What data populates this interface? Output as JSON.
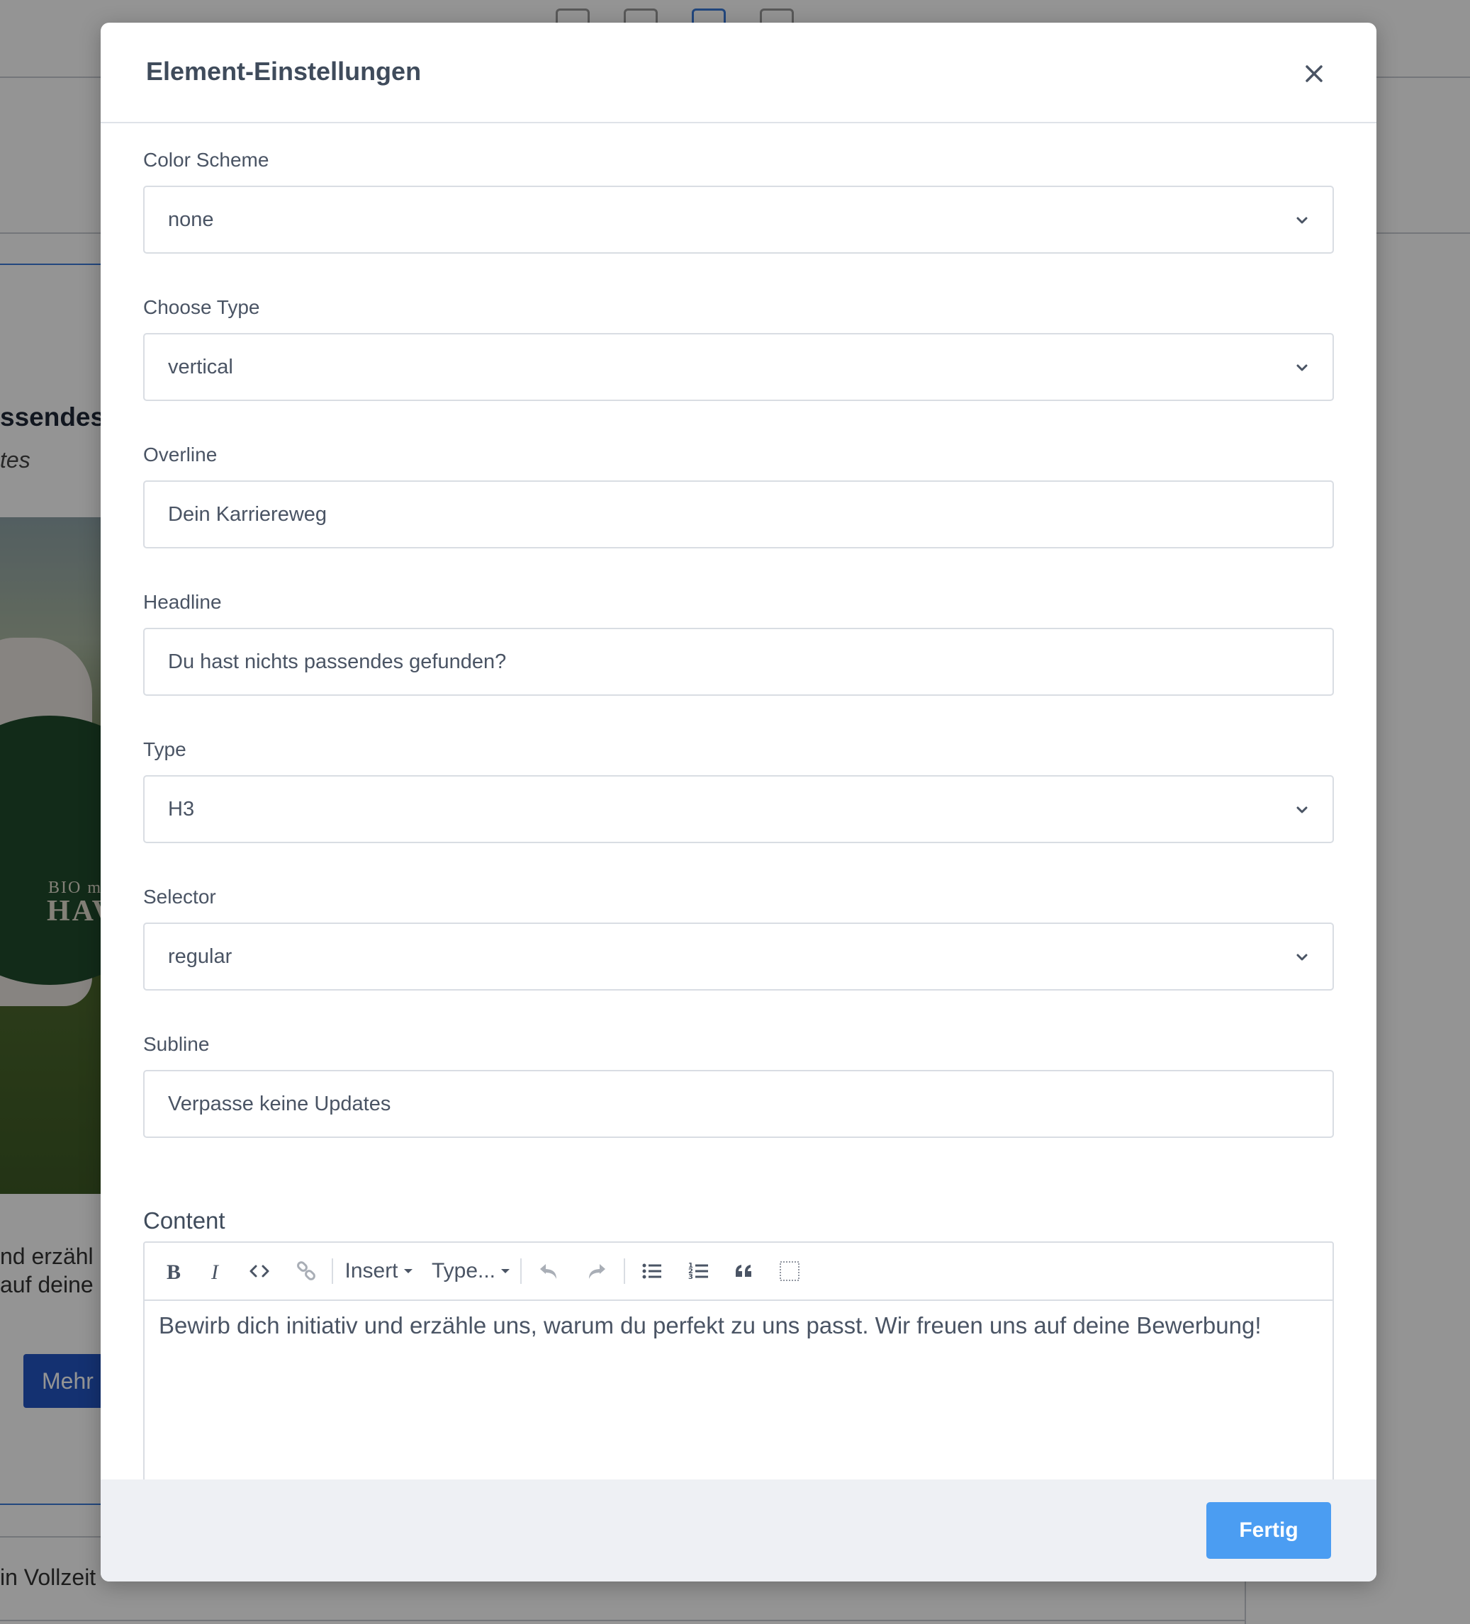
{
  "background": {
    "headline_fragment": "ssendes",
    "subline_fragment": "tes",
    "logo_line1": "BIO m",
    "logo_line2": "HAV",
    "text_fragment_1": "nd erzähl",
    "text_fragment_2": " auf deine",
    "button_fragment": "Mehr",
    "vollzeit_fragment": "in Vollzeit"
  },
  "modal": {
    "title": "Element-Einstellungen",
    "close_icon": "close-icon",
    "fields": {
      "color_scheme": {
        "label": "Color Scheme",
        "value": "none"
      },
      "choose_type": {
        "label": "Choose Type",
        "value": "vertical"
      },
      "overline": {
        "label": "Overline",
        "value": "Dein Karriereweg"
      },
      "headline": {
        "label": "Headline",
        "value": "Du hast nichts passendes gefunden?"
      },
      "type": {
        "label": "Type",
        "value": "H3"
      },
      "selector": {
        "label": "Selector",
        "value": "regular"
      },
      "subline": {
        "label": "Subline",
        "value": "Verpasse keine Updates"
      }
    },
    "content": {
      "label": "Content",
      "toolbar": {
        "insert_label": "Insert",
        "type_label": "Type..."
      },
      "text": "Bewirb dich initiativ und erzähle uns, warum du perfekt zu uns passt. Wir freuen uns auf deine Bewerbung!"
    },
    "done_label": "Fertig"
  },
  "colors": {
    "primary_button": "#4b9df2",
    "background_button": "#2455c3",
    "overlay": "rgba(0,0,0,0.42)"
  }
}
